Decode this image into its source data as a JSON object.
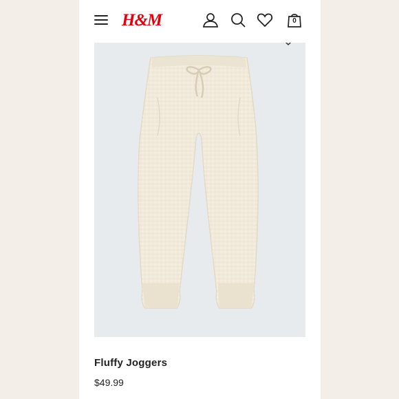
{
  "header": {
    "logo_text": "H&M",
    "logo_color": "#e50010",
    "icons": [
      "menu-icon",
      "account-icon",
      "search-icon",
      "favorites-icon",
      "shopping-bag-icon"
    ],
    "bag_count": "0"
  },
  "product": {
    "image_subject": "cream fluffy knit joggers with drawstring",
    "name": "Fluffy Joggers",
    "price": "$49.99"
  },
  "colors": {
    "page_background": "#f4eee8",
    "image_background": "#e8ebee",
    "garment": "#f1eadb"
  }
}
